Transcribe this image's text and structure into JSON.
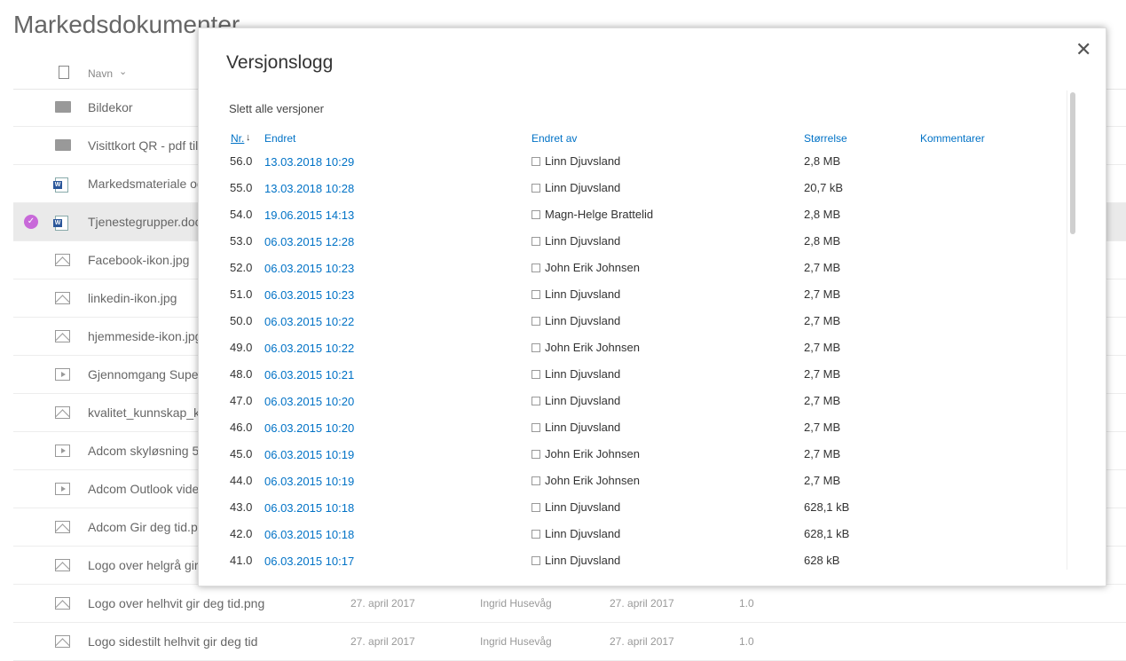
{
  "library": {
    "title": "Markedsdokumenter",
    "column_name": "Navn",
    "files": [
      {
        "name": "Bildekor",
        "type": "folder",
        "selected": false
      },
      {
        "name": "Visittkort QR - pdf til",
        "type": "folder",
        "selected": false
      },
      {
        "name": "Markedsmateriale og",
        "type": "word",
        "selected": false
      },
      {
        "name": "Tjenestegrupper.doc",
        "type": "word",
        "selected": true
      },
      {
        "name": "Facebook-ikon.jpg",
        "type": "image",
        "selected": false
      },
      {
        "name": "linkedin-ikon.jpg",
        "type": "image",
        "selected": false
      },
      {
        "name": "hjemmeside-ikon.jpg",
        "type": "image",
        "selected": false
      },
      {
        "name": "Gjennomgang Super",
        "type": "video",
        "selected": false
      },
      {
        "name": "kvalitet_kunnskap_ku",
        "type": "image",
        "selected": false
      },
      {
        "name": "Adcom skyløsning 5",
        "type": "video",
        "selected": false
      },
      {
        "name": "Adcom Outlook vide",
        "type": "video",
        "selected": false
      },
      {
        "name": "Adcom Gir deg tid.p",
        "type": "image",
        "selected": false
      },
      {
        "name": "Logo over helgrå gir",
        "type": "image",
        "selected": false
      },
      {
        "name": "Logo over helhvit gir deg tid.png",
        "type": "image",
        "selected": false,
        "modified": "27. april 2017",
        "modified_by": "Ingrid Husevåg",
        "created": "27. april 2017",
        "version": "1.0"
      },
      {
        "name": "Logo sidestilt helhvit gir deg tid",
        "type": "image",
        "selected": false,
        "modified": "27. april 2017",
        "modified_by": "Ingrid Husevåg",
        "created": "27. april 2017",
        "version": "1.0"
      }
    ]
  },
  "dialog": {
    "title": "Versjonslogg",
    "close_icon": "close-icon",
    "delete_all": "Slett alle versjoner",
    "headers": {
      "nr": "Nr.",
      "modified": "Endret",
      "modified_by": "Endret av",
      "size": "Størrelse",
      "comments": "Kommentarer"
    },
    "versions": [
      {
        "nr": "56.0",
        "date": "13.03.2018 10:29",
        "user": "Linn Djuvsland",
        "size": "2,8 MB"
      },
      {
        "nr": "55.0",
        "date": "13.03.2018 10:28",
        "user": "Linn Djuvsland",
        "size": "20,7 kB"
      },
      {
        "nr": "54.0",
        "date": "19.06.2015 14:13",
        "user": "Magn-Helge Brattelid",
        "size": "2,8 MB"
      },
      {
        "nr": "53.0",
        "date": "06.03.2015 12:28",
        "user": "Linn Djuvsland",
        "size": "2,8 MB"
      },
      {
        "nr": "52.0",
        "date": "06.03.2015 10:23",
        "user": "John Erik Johnsen",
        "size": "2,7 MB"
      },
      {
        "nr": "51.0",
        "date": "06.03.2015 10:23",
        "user": "Linn Djuvsland",
        "size": "2,7 MB"
      },
      {
        "nr": "50.0",
        "date": "06.03.2015 10:22",
        "user": "Linn Djuvsland",
        "size": "2,7 MB"
      },
      {
        "nr": "49.0",
        "date": "06.03.2015 10:22",
        "user": "John Erik Johnsen",
        "size": "2,7 MB"
      },
      {
        "nr": "48.0",
        "date": "06.03.2015 10:21",
        "user": "Linn Djuvsland",
        "size": "2,7 MB"
      },
      {
        "nr": "47.0",
        "date": "06.03.2015 10:20",
        "user": "Linn Djuvsland",
        "size": "2,7 MB"
      },
      {
        "nr": "46.0",
        "date": "06.03.2015 10:20",
        "user": "Linn Djuvsland",
        "size": "2,7 MB"
      },
      {
        "nr": "45.0",
        "date": "06.03.2015 10:19",
        "user": "John Erik Johnsen",
        "size": "2,7 MB"
      },
      {
        "nr": "44.0",
        "date": "06.03.2015 10:19",
        "user": "John Erik Johnsen",
        "size": "2,7 MB"
      },
      {
        "nr": "43.0",
        "date": "06.03.2015 10:18",
        "user": "Linn Djuvsland",
        "size": "628,1 kB"
      },
      {
        "nr": "42.0",
        "date": "06.03.2015 10:18",
        "user": "Linn Djuvsland",
        "size": "628,1 kB"
      },
      {
        "nr": "41.0",
        "date": "06.03.2015 10:17",
        "user": "Linn Djuvsland",
        "size": "628 kB"
      }
    ]
  },
  "colors": {
    "link": "#0072c6",
    "selection_check": "#c869d9"
  }
}
